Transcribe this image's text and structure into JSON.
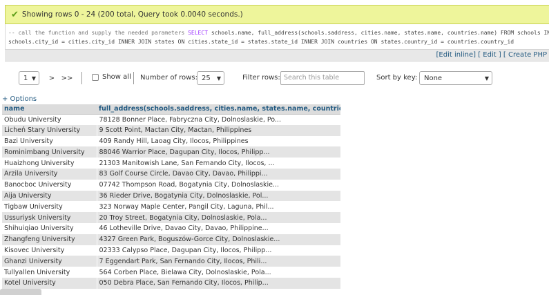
{
  "success": {
    "message": "Showing rows 0 - 24 (200 total, Query took 0.0040 seconds.)"
  },
  "sql": {
    "comment": "-- call the function and supply the needed parameters",
    "line1_rest": "schools.name, full_address(schools.saddress, cities.name, states.name, countries.name) FROM schools INNER JOIN cities ON",
    "kw_select": "SELECT",
    "line2": "schools.city_id = cities.city_id INNER JOIN states ON cities.state_id = states.state_id INNER JOIN countries ON states.country_id = countries.country_id"
  },
  "sqlbar": {
    "edit_inline": "[Edit inline]",
    "edit": "[ Edit ]",
    "create_php": "[ Create PHP"
  },
  "nav": {
    "page_value": "1",
    "next": ">",
    "last": ">>",
    "show_all": "Show all",
    "number_of_rows_label": "Number of rows:",
    "number_of_rows_value": "25",
    "filter_label": "Filter rows:",
    "filter_placeholder": "Search this table",
    "sort_label": "Sort by key:",
    "sort_value": "None"
  },
  "options": "+ Options",
  "table": {
    "headers": [
      "name",
      "full_address(schools.saddress, cities.name, states.name, countries.name)"
    ],
    "rows": [
      [
        "Obudu University",
        "78128 Bonner Place, Fabryczna City, Dolnoslaskie, Po..."
      ],
      [
        "Licheń Stary University",
        "9 Scott Point, Mactan City, Mactan, Philippines"
      ],
      [
        "Bazi University",
        "409 Randy Hill, Laoag City, Ilocos, Philippines"
      ],
      [
        "Rominimbang University",
        "88046 Warrior Place, Dagupan City, Ilocos, Philipp..."
      ],
      [
        "Huaizhong University",
        "21303 Manitowish Lane, San Fernando City, Ilocos, ..."
      ],
      [
        "Arzila University",
        "83 Golf Course Circle, Davao City, Davao, Philippi..."
      ],
      [
        "Banocboc University",
        "07742 Thompson Road, Bogatynia City, Dolnoslaskie..."
      ],
      [
        "Aija University",
        "36 Rieder Drive, Bogatynia City, Dolnoslaskie, Pol..."
      ],
      [
        "Tigbaw University",
        "323 Norway Maple Center, Pangil City, Laguna, Phil..."
      ],
      [
        "Ussuriysk University",
        "20 Troy Street, Bogatynia City, Dolnoslaskie, Pola..."
      ],
      [
        "Shihuiqiao University",
        "46 Lotheville Drive, Davao City, Davao, Philippine..."
      ],
      [
        "Zhangfeng University",
        "4327 Green Park, Boguszów-Gorce City, Dolnoslaskie..."
      ],
      [
        "Kisovec University",
        "02333 Calypso Place, Dagupan City, Ilocos, Philipp..."
      ],
      [
        "Ghanzi University",
        "7 Eggendart Park, San Fernando City, Ilocos, Phili..."
      ],
      [
        "Tullyallen University",
        "564 Corben Place, Bielawa City, Dolnoslaskie, Pola..."
      ],
      [
        "Kotel University",
        "050 Debra Place, San Fernando City, Ilocos, Philip..."
      ]
    ]
  }
}
